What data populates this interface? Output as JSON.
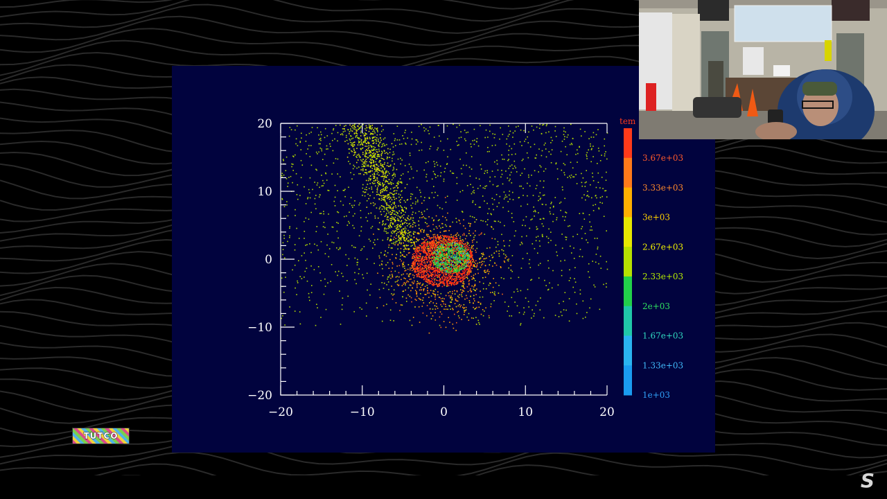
{
  "video": {
    "logo_badge_text": "TUTCO",
    "channel_logo_char": "S"
  },
  "plot": {
    "colorbar_title": "tem",
    "x_ticks": [
      "−20",
      "−10",
      "0",
      "10",
      "20"
    ],
    "y_ticks": [
      "20",
      "10",
      "0",
      "−10",
      "−20"
    ],
    "colorbar_labels": [
      "3.67e+03",
      "3.33e+03",
      "3e+03",
      "2.67e+03",
      "2.33e+03",
      "2e+03",
      "1.67e+03",
      "1.33e+03",
      "1e+03"
    ]
  },
  "chart_data": {
    "type": "scatter",
    "title": "",
    "xlabel": "",
    "ylabel": "",
    "xlim": [
      -20,
      20
    ],
    "ylim": [
      -20,
      20
    ],
    "x_tick_values": [
      -20,
      -10,
      0,
      10,
      20
    ],
    "y_tick_values": [
      -20,
      -10,
      0,
      10,
      20
    ],
    "colorbar": {
      "label": "tem",
      "range": [
        1000,
        3900
      ],
      "ticks": [
        3670,
        3330,
        3000,
        2670,
        2330,
        2000,
        1670,
        1330,
        1000
      ],
      "colors": [
        "#ff3a1a",
        "#ff7a1a",
        "#ffb000",
        "#e6e800",
        "#b7e000",
        "#22d04a",
        "#20c8a8",
        "#2ab4f0",
        "#1a9cf0"
      ],
      "label_colors": [
        "#ff5a2a",
        "#ff8a2a",
        "#ffd000",
        "#f0f000",
        "#b8ee00",
        "#30e060",
        "#30d8c0",
        "#40b8f8",
        "#30a0f8"
      ]
    },
    "features": [
      {
        "name": "dense_core",
        "center": [
          -0.2,
          -0.2
        ],
        "radius": 3.8,
        "temp": 3900
      },
      {
        "name": "inner_cool_region",
        "center": [
          0.8,
          0.3
        ],
        "radius": 2.3,
        "temp": 2100
      },
      {
        "name": "stream_tail",
        "from": [
          -10.5,
          20
        ],
        "to": [
          -4.5,
          2
        ],
        "temp": 2800
      },
      {
        "name": "diffuse_halo",
        "extent": [
          -20,
          20,
          -10,
          20
        ],
        "temp": 2700
      }
    ]
  }
}
